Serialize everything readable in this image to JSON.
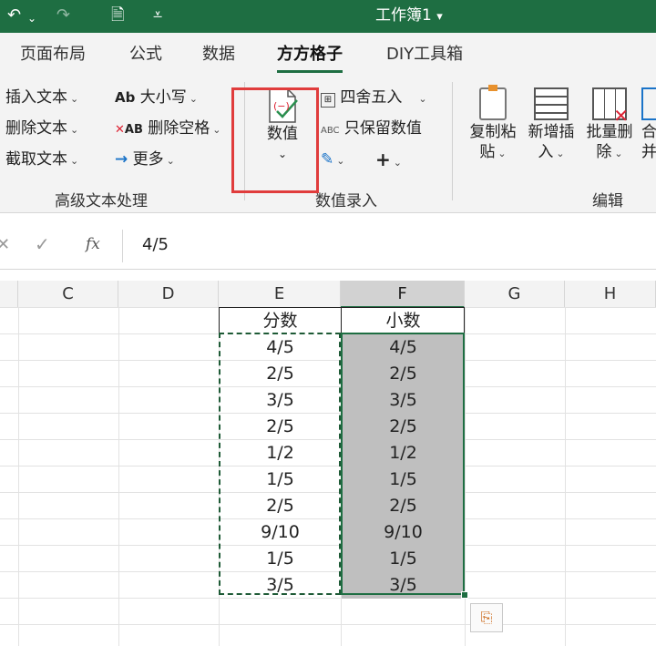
{
  "titlebar": {
    "title": "工作簿1",
    "title_chevron": "▾",
    "undo_icon": "↶",
    "redo_icon": "↷",
    "doc_icon": "🗎",
    "more_icon": "⩡"
  },
  "tabs": [
    {
      "label": "页面布局"
    },
    {
      "label": "公式"
    },
    {
      "label": "数据"
    },
    {
      "label": "方方格子",
      "active": true
    },
    {
      "label": "DIY工具箱"
    }
  ],
  "ribbon": {
    "text_group": {
      "label": "高级文本处理",
      "items": [
        "插入文本",
        "删除文本",
        "截取文本",
        "大小写",
        "删除空格",
        "更多"
      ],
      "ab_glyph": "Ab",
      "xab_glyph": "AB",
      "arrow_glyph": "→"
    },
    "value_group": {
      "label": "数值录入",
      "big_button": "数值",
      "items": [
        "四舍五入",
        "只保留数值"
      ],
      "plus_glyph": "+",
      "abc_glyph": "ABC",
      "big_icon_glyph": "(−)",
      "pencil_glyph": "✎"
    },
    "edit_group": {
      "label": "编辑",
      "buttons": [
        {
          "line1": "复制粘",
          "line2": "贴"
        },
        {
          "line1": "新增插",
          "line2": "入"
        },
        {
          "line1": "批量删",
          "line2": "除"
        },
        {
          "line1": "合",
          "line2": "并"
        }
      ]
    },
    "chevron": "⌄"
  },
  "formula_bar": {
    "cancel_icon": "✕",
    "confirm_icon": "✓",
    "fx_label": "fx",
    "content": "4/5"
  },
  "columns": [
    "C",
    "D",
    "E",
    "F",
    "G",
    "H"
  ],
  "table": {
    "headers": [
      "分数",
      "小数"
    ],
    "rows": [
      [
        "4/5",
        "4/5"
      ],
      [
        "2/5",
        "2/5"
      ],
      [
        "3/5",
        "3/5"
      ],
      [
        "2/5",
        "2/5"
      ],
      [
        "1/2",
        "1/2"
      ],
      [
        "1/5",
        "1/5"
      ],
      [
        "2/5",
        "2/5"
      ],
      [
        "9/10",
        "9/10"
      ],
      [
        "1/5",
        "1/5"
      ],
      [
        "3/5",
        "3/5"
      ]
    ]
  },
  "paste_options_icon": "⎘",
  "colors": {
    "accent": "#1e6e42",
    "highlight_box": "#e03c3c",
    "selection_fill": "#bfbfbf"
  }
}
